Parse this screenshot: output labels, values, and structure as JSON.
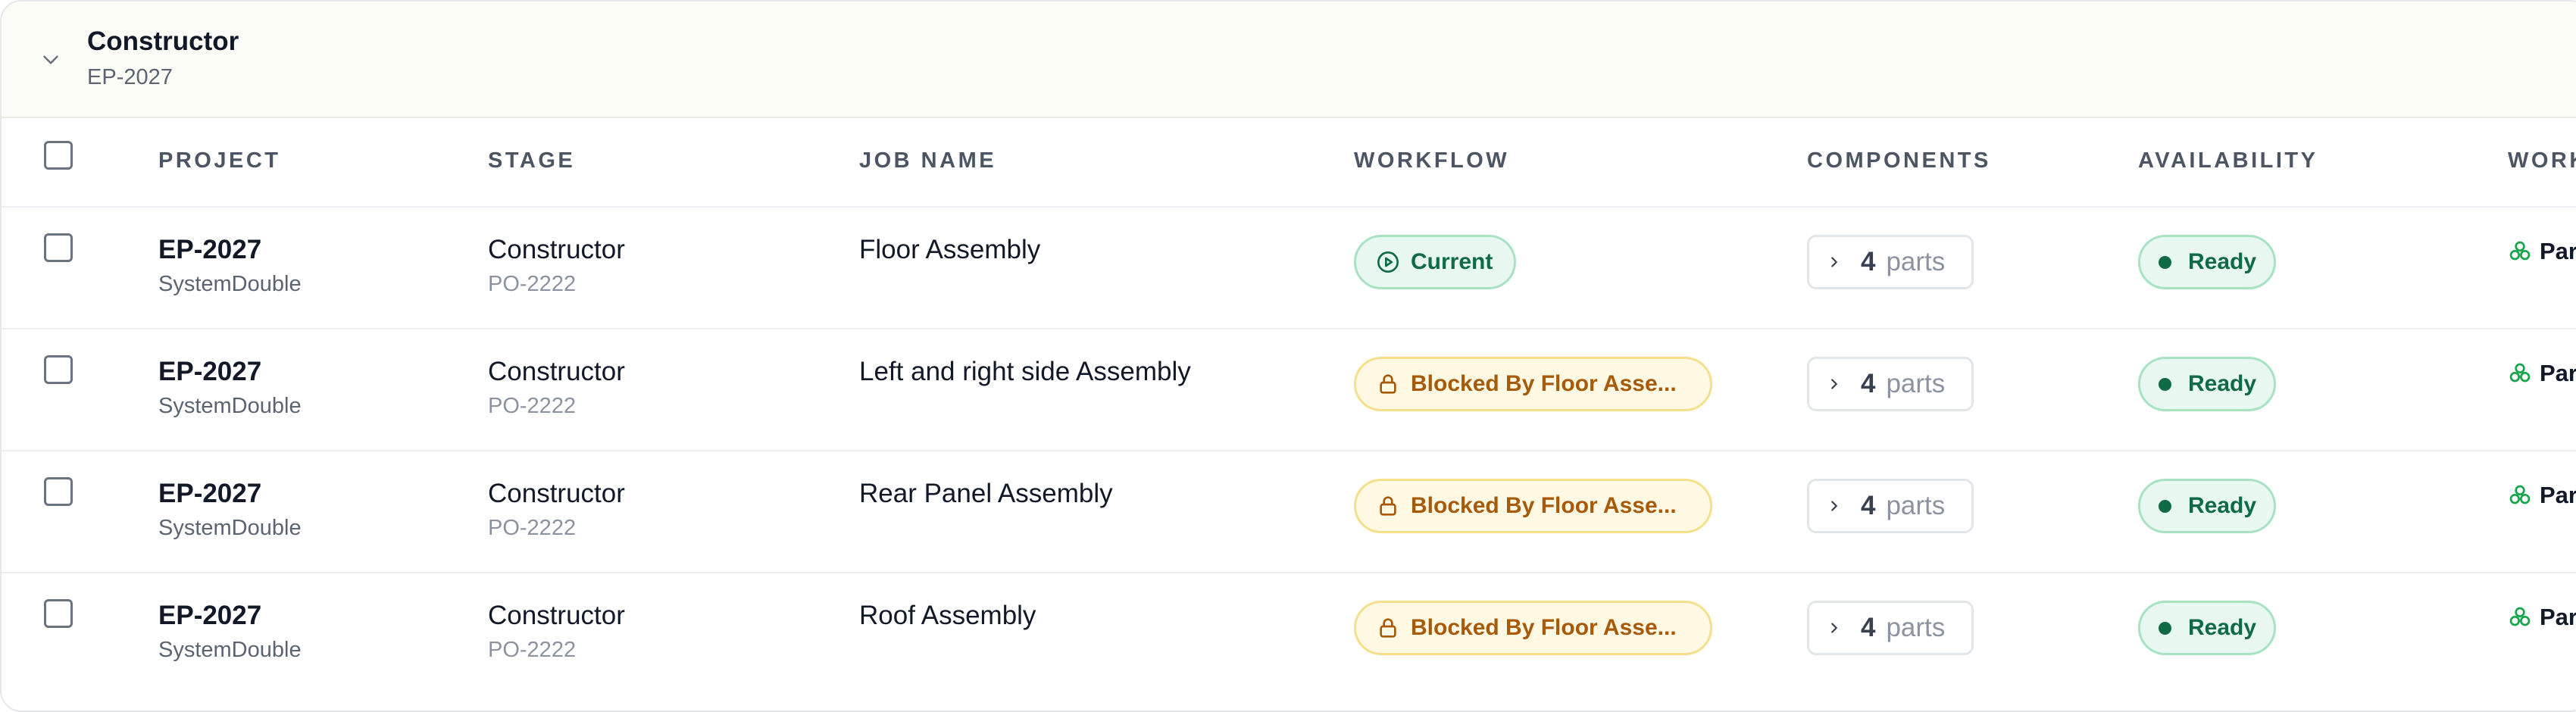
{
  "group": {
    "title": "Constructor",
    "code": "EP-2027"
  },
  "columns": {
    "project": "PROJECT",
    "stage": "STAGE",
    "job_name": "JOB NAME",
    "workflow": "WORKFLOW",
    "components": "COMPONENTS",
    "availability": "AVAILABILITY",
    "work": "WORK"
  },
  "rows": [
    {
      "project": "EP-2027",
      "project_sub": "SystemDouble",
      "stage": "Constructor",
      "stage_sub": "PO-2222",
      "job_name": "Floor Assembly",
      "workflow": "Current",
      "components_count": "4",
      "components_unit": "parts",
      "availability": "Ready",
      "work": "Par"
    },
    {
      "project": "EP-2027",
      "project_sub": "SystemDouble",
      "stage": "Constructor",
      "stage_sub": "PO-2222",
      "job_name": "Left and right side Assembly",
      "workflow": "Blocked By Floor Asse...",
      "components_count": "4",
      "components_unit": "parts",
      "availability": "Ready",
      "work": "Par"
    },
    {
      "project": "EP-2027",
      "project_sub": "SystemDouble",
      "stage": "Constructor",
      "stage_sub": "PO-2222",
      "job_name": "Rear Panel Assembly",
      "workflow": "Blocked By Floor Asse...",
      "components_count": "4",
      "components_unit": "parts",
      "availability": "Ready",
      "work": "Par"
    },
    {
      "project": "EP-2027",
      "project_sub": "SystemDouble",
      "stage": "Constructor",
      "stage_sub": "PO-2222",
      "job_name": "Roof Assembly",
      "workflow": "Blocked By Floor Asse...",
      "components_count": "4",
      "components_unit": "parts",
      "availability": "Ready",
      "work": "Par"
    }
  ],
  "colors": {
    "ready_green": "#0f6b45",
    "blocked_amber": "#a65a0a",
    "header_bg": "#fafcf5"
  },
  "icons": {
    "group_toggle": "chevron-down-icon",
    "current": "play-circle-icon",
    "blocked": "lock-icon",
    "expand_parts": "chevron-right-icon",
    "work": "cubes-icon"
  }
}
